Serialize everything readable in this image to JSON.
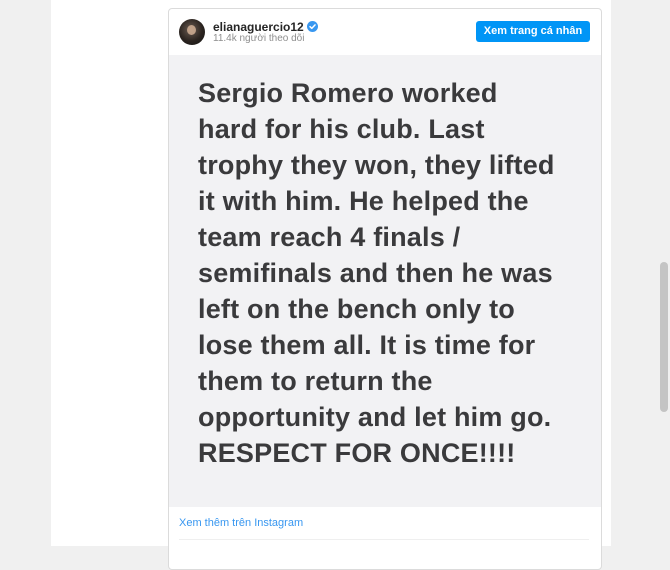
{
  "post": {
    "username": "elianaguercio12",
    "followers": "11.4k người theo dõi",
    "view_profile_label": "Xem trang cá nhân",
    "image_text_lines": [
      "Sergio Romero worked",
      "hard for his club. Last",
      "trophy they won, they lifted",
      "it with him. He helped the",
      "team reach 4 finals /",
      "semifinals and then he was",
      "left on the bench only to",
      "lose them all. It is time for",
      "them to return the",
      "opportunity and let him go.",
      "RESPECT FOR ONCE!!!!"
    ],
    "more_link": "Xem thêm trên Instagram"
  },
  "colors": {
    "accent": "#0095f6",
    "link": "#3897f0",
    "verified": "#3897f0",
    "post_text": "#3a3a3c",
    "post_background": "#f2f2f4"
  },
  "icons": {
    "verified": "verified-badge-icon"
  }
}
